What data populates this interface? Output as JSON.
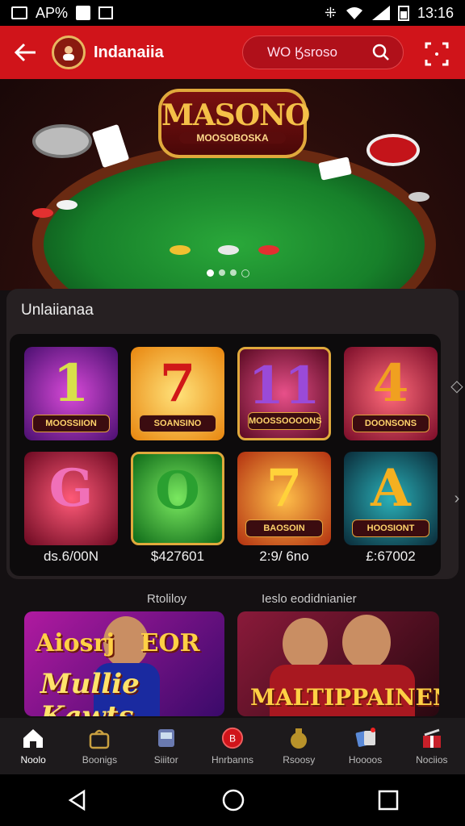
{
  "status_bar": {
    "carrier": "AP%",
    "time": "13:16",
    "icons": [
      "screenshot-icon",
      "notification-icon",
      "image-icon",
      "wifi-icon",
      "signal-icon",
      "battery-icon"
    ]
  },
  "header": {
    "app_name": "Indanaiia",
    "search_text": "WO Ӄsroso",
    "icons": [
      "back-arrow-icon",
      "logo-icon",
      "search-icon",
      "grid-menu-icon"
    ]
  },
  "hero": {
    "title": "MASONO",
    "subtitle": "MOOSOBOSKA",
    "carousel_dots": 4,
    "active_dot": 0
  },
  "games": {
    "section_title": "Unlaiianaa",
    "tiles": [
      {
        "symbol": "1",
        "label": "MOOSSIION",
        "bg": "#7a1fa8"
      },
      {
        "symbol": "7",
        "label": "SOANSINO",
        "bg": "#f0a21a"
      },
      {
        "symbol": "11",
        "label": "MOOSSOOOONS",
        "bg": "#8a1530"
      },
      {
        "symbol": "4",
        "label": "DOONSONS",
        "bg": "#b0183a"
      },
      {
        "symbol": "G",
        "label": "",
        "bg": "#b0183a"
      },
      {
        "symbol": "O",
        "label": "",
        "bg": "#1f9a2a"
      },
      {
        "symbol": "7",
        "label": "BAOSOIN",
        "bg": "#e26a12"
      },
      {
        "symbol": "A",
        "label": "HOOSIONT",
        "bg": "#0d6e78"
      }
    ],
    "prices": [
      "ds.6/00N",
      "$427601",
      "2:9/ 6no",
      "£:67002"
    ]
  },
  "promos": {
    "heading_left": "Rtoliloy",
    "heading_right": "Ieslo eodidnianier",
    "left_text_top": "Aiosrj   EOR",
    "left_text_bottom": "Mullie Kawts",
    "right_text": "MALTIPPAINEN"
  },
  "bottom_nav": {
    "items": [
      {
        "label": "Noolo",
        "icon": "home-icon"
      },
      {
        "label": "Boonigs",
        "icon": "bag-icon"
      },
      {
        "label": "Siiitor",
        "icon": "slot-machine-icon"
      },
      {
        "label": "Hnrbanns",
        "icon": "coin-icon"
      },
      {
        "label": "Rsoosy",
        "icon": "money-bag-icon"
      },
      {
        "label": "Hoooos",
        "icon": "cards-icon"
      },
      {
        "label": "Nociios",
        "icon": "gift-icon"
      }
    ],
    "active_index": 0
  },
  "system_nav": [
    "back-triangle-icon",
    "home-circle-icon",
    "recents-square-icon"
  ],
  "colors": {
    "header_red": "#d0141a",
    "bg": "#141012",
    "gold": "#f4c048"
  }
}
